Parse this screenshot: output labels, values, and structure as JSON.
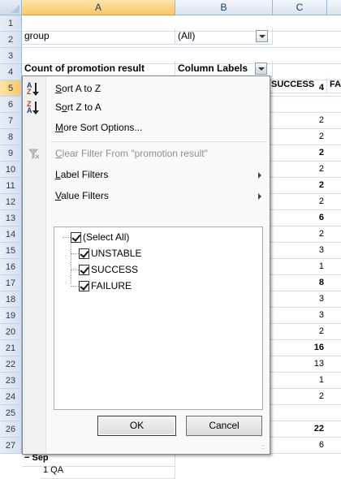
{
  "columns": {
    "a": "A",
    "b": "B",
    "c": "C"
  },
  "rows": [
    "1",
    "2",
    "3",
    "4",
    "5",
    "6",
    "7",
    "8",
    "9",
    "10",
    "11",
    "12",
    "13",
    "14",
    "15",
    "16",
    "17",
    "18",
    "19",
    "20",
    "21",
    "22",
    "23",
    "24",
    "25",
    "26",
    "27"
  ],
  "cells": {
    "a1": "group",
    "b1": "(All)",
    "a3": "Count of promotion result",
    "b3": "Column Labels",
    "c4": "SUCCESS",
    "d4": "FA",
    "a26": "− Sep",
    "a27": "1 QA"
  },
  "column_c_values": [
    {
      "row": "5",
      "value": "4",
      "bold": true
    },
    {
      "row": "7",
      "value": "2",
      "bold": false
    },
    {
      "row": "8",
      "value": "2",
      "bold": false
    },
    {
      "row": "9",
      "value": "2",
      "bold": true
    },
    {
      "row": "10",
      "value": "2",
      "bold": false
    },
    {
      "row": "11",
      "value": "2",
      "bold": true
    },
    {
      "row": "12",
      "value": "2",
      "bold": false
    },
    {
      "row": "13",
      "value": "6",
      "bold": true
    },
    {
      "row": "14",
      "value": "2",
      "bold": false
    },
    {
      "row": "15",
      "value": "3",
      "bold": false
    },
    {
      "row": "16",
      "value": "1",
      "bold": false
    },
    {
      "row": "17",
      "value": "8",
      "bold": true
    },
    {
      "row": "18",
      "value": "3",
      "bold": false
    },
    {
      "row": "19",
      "value": "3",
      "bold": false
    },
    {
      "row": "20",
      "value": "2",
      "bold": false
    },
    {
      "row": "21",
      "value": "16",
      "bold": true
    },
    {
      "row": "22",
      "value": "13",
      "bold": false
    },
    {
      "row": "23",
      "value": "1",
      "bold": false
    },
    {
      "row": "24",
      "value": "2",
      "bold": false
    },
    {
      "row": "26",
      "value": "22",
      "bold": true
    },
    {
      "row": "27",
      "value": "6",
      "bold": false
    }
  ],
  "menu": {
    "sort_az": {
      "pre": "",
      "u": "S",
      "post": "ort A to Z"
    },
    "sort_za": {
      "pre": "S",
      "u": "o",
      "post": "rt Z to A"
    },
    "more_sort": {
      "pre": "",
      "u": "M",
      "post": "ore Sort Options..."
    },
    "clear_filter": {
      "pre": "",
      "u": "C",
      "post": "lear Filter From \"promotion result\""
    },
    "label_filters": {
      "pre": "",
      "u": "L",
      "post": "abel Filters"
    },
    "value_filters": {
      "pre": "",
      "u": "V",
      "post": "alue Filters"
    }
  },
  "filter_list": {
    "items": [
      {
        "label": "(Select All)",
        "checked": true
      },
      {
        "label": "UNSTABLE",
        "checked": true
      },
      {
        "label": "SUCCESS",
        "checked": true
      },
      {
        "label": "FAILURE",
        "checked": true
      }
    ]
  },
  "buttons": {
    "ok": "OK",
    "cancel": "Cancel"
  },
  "icons": {
    "sort_az": "sort-ascending-icon",
    "sort_za": "sort-descending-icon",
    "clear_filter": "clear-filter-icon",
    "submenu": "submenu-arrow-icon",
    "dropdown": "dropdown-arrow-icon",
    "resize": "resize-grip-icon"
  },
  "colors": {
    "selection_header": "#f9c66b",
    "header": "#d9e3f0",
    "grid_line": "#d4dbe4",
    "menu_border": "#868686"
  }
}
